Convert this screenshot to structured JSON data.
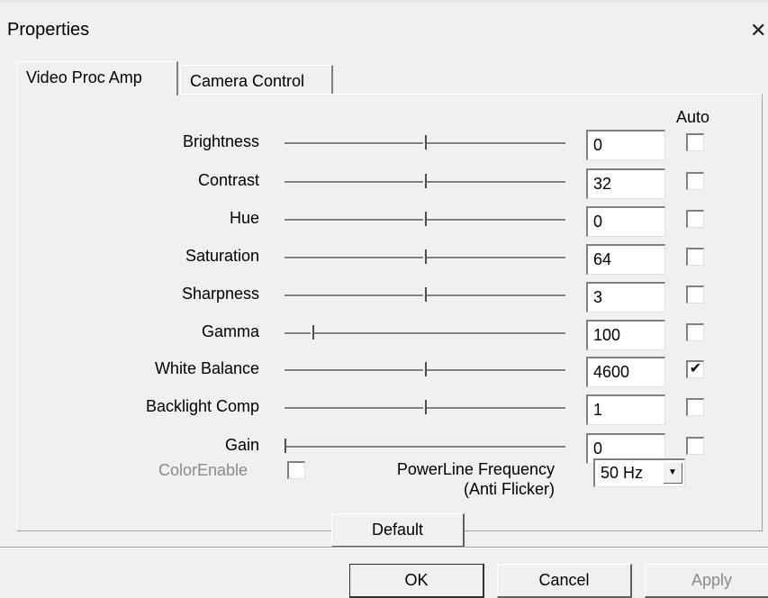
{
  "window": {
    "title": "Properties",
    "close_glyph": "✕"
  },
  "tabs": [
    {
      "label": "Video Proc Amp",
      "active": true
    },
    {
      "label": "Camera Control",
      "active": false
    }
  ],
  "auto_header": "Auto",
  "controls": [
    {
      "label": "Brightness",
      "value": "0",
      "auto": false,
      "level": 0.5
    },
    {
      "label": "Contrast",
      "value": "32",
      "auto": false,
      "level": 0.5
    },
    {
      "label": "Hue",
      "value": "0",
      "auto": false,
      "level": 0.5
    },
    {
      "label": "Saturation",
      "value": "64",
      "auto": false,
      "level": 0.5
    },
    {
      "label": "Sharpness",
      "value": "3",
      "auto": false,
      "level": 0.5
    },
    {
      "label": "Gamma",
      "value": "100",
      "auto": false,
      "level": 0.1
    },
    {
      "label": "White Balance",
      "value": "4600",
      "auto": true,
      "level": 0.5
    },
    {
      "label": "Backlight Comp",
      "value": "1",
      "auto": false,
      "level": 0.5
    },
    {
      "label": "Gain",
      "value": "0",
      "auto": false,
      "level": 0.0
    }
  ],
  "color_enable": {
    "label": "ColorEnable",
    "checked": false,
    "disabled": true
  },
  "powerline": {
    "label_line1": "PowerLine Frequency",
    "label_line2": "(Anti Flicker)",
    "selected": "50 Hz",
    "arrow_icon": "▼"
  },
  "buttons": {
    "default": "Default",
    "ok": "OK",
    "cancel": "Cancel",
    "apply": "Apply"
  }
}
